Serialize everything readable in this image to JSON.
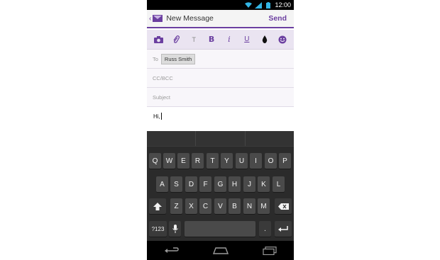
{
  "status_bar": {
    "time": "12:00",
    "icons": [
      "wifi-icon",
      "signal-icon",
      "battery-icon"
    ]
  },
  "app_bar": {
    "title": "New Message",
    "send_label": "Send",
    "back_icon": "chevron-left-icon",
    "app_icon": "mail-icon"
  },
  "toolbar": {
    "items": [
      {
        "name": "camera-icon"
      },
      {
        "name": "paperclip-icon"
      },
      {
        "name": "font-size-icon",
        "label": "T"
      },
      {
        "name": "bold-icon",
        "label": "B"
      },
      {
        "name": "italic-icon",
        "label": "i"
      },
      {
        "name": "underline-icon",
        "label": "U"
      },
      {
        "name": "color-drop-icon"
      },
      {
        "name": "smiley-icon"
      }
    ]
  },
  "fields": {
    "to_label": "To",
    "to_recipient": "Russ Smith",
    "cc_label": "CC/BCC",
    "subject_label": "Subject"
  },
  "body": {
    "text": "Hi,"
  },
  "keyboard": {
    "row1": [
      "Q",
      "W",
      "E",
      "R",
      "T",
      "Y",
      "U",
      "I",
      "O",
      "P"
    ],
    "row2": [
      "A",
      "S",
      "D",
      "F",
      "G",
      "H",
      "J",
      "K",
      "L"
    ],
    "row3": [
      "Z",
      "X",
      "C",
      "V",
      "B",
      "N",
      "M"
    ],
    "symbols_label": "?123",
    "period_label": ".",
    "icons": [
      "shift-icon",
      "backspace-icon",
      "microphone-icon",
      "enter-icon"
    ]
  },
  "nav_bar": {
    "icons": [
      "back-icon",
      "home-icon",
      "recents-icon"
    ]
  },
  "colors": {
    "accent": "#6b3fa0",
    "keyboard_bg": "#2b2b2b",
    "key": "#4a4a4a"
  }
}
